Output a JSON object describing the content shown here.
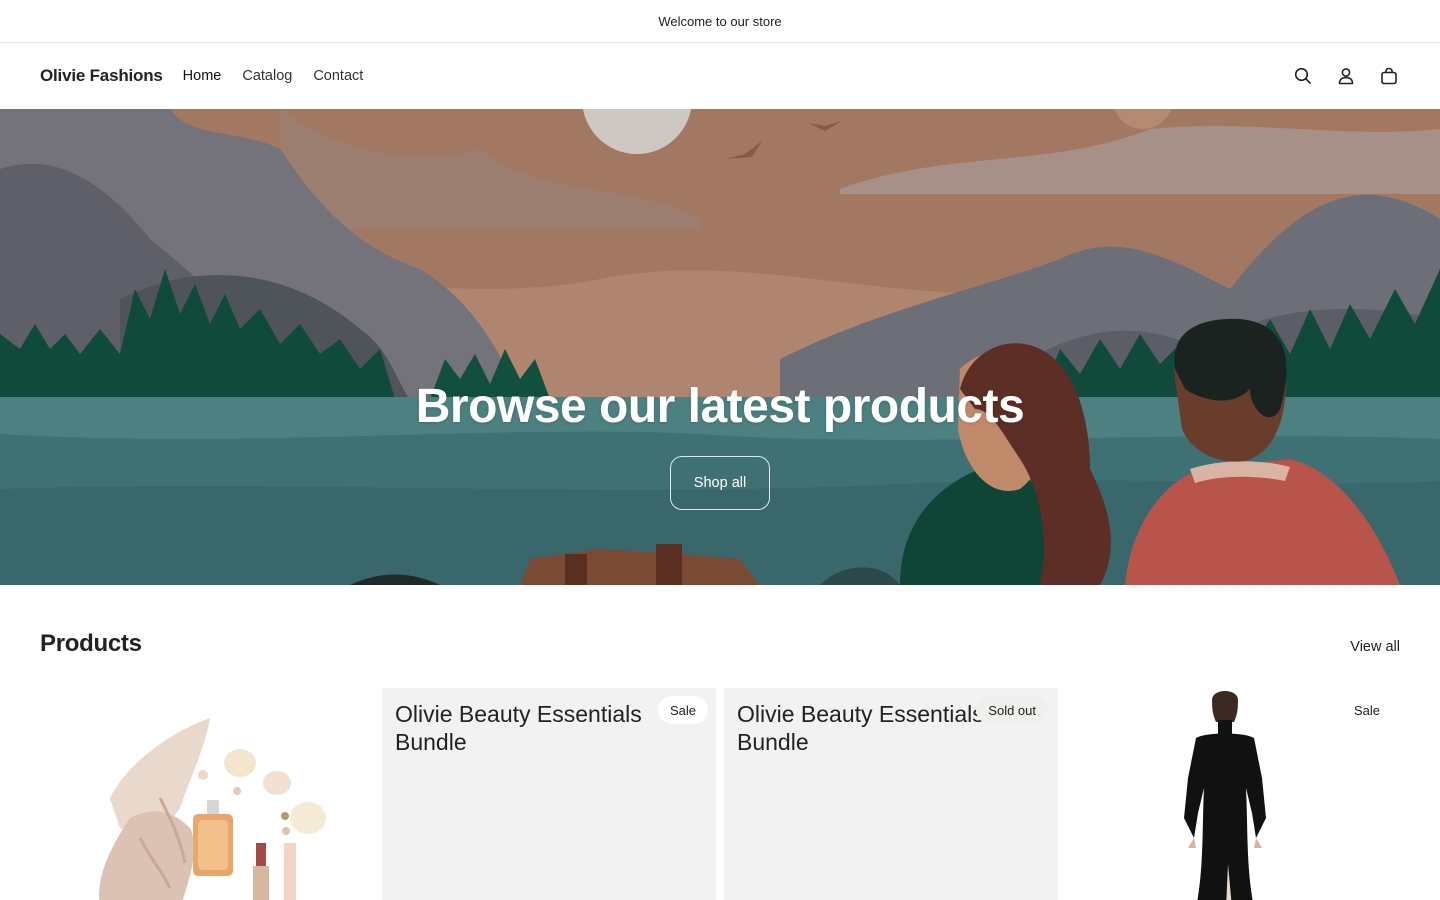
{
  "announcement": {
    "text": "Welcome to our store"
  },
  "header": {
    "logo": "Olivie Fashions",
    "nav": [
      {
        "label": "Home"
      },
      {
        "label": "Catalog"
      },
      {
        "label": "Contact"
      }
    ],
    "icons": [
      "search-icon",
      "account-icon",
      "cart-icon"
    ]
  },
  "hero": {
    "title": "Browse our latest products",
    "button_label": "Shop all"
  },
  "products": {
    "title": "Products",
    "view_all": "View all",
    "items": [
      {
        "title": "",
        "badge": "",
        "image": "beauty-products-photo"
      },
      {
        "title": "Olivie Beauty Essentials Bundle",
        "badge": "Sale",
        "image": ""
      },
      {
        "title": "Olivie Beauty Essentials Bundle",
        "badge": "Sold out",
        "image": ""
      },
      {
        "title": "",
        "badge": "Sale",
        "image": "black-dress-photo"
      }
    ]
  },
  "colors": {
    "text": "#222222",
    "placeholder_bg": "#f2f2f2",
    "sold_out_badge_bg": "#eef0ec"
  }
}
